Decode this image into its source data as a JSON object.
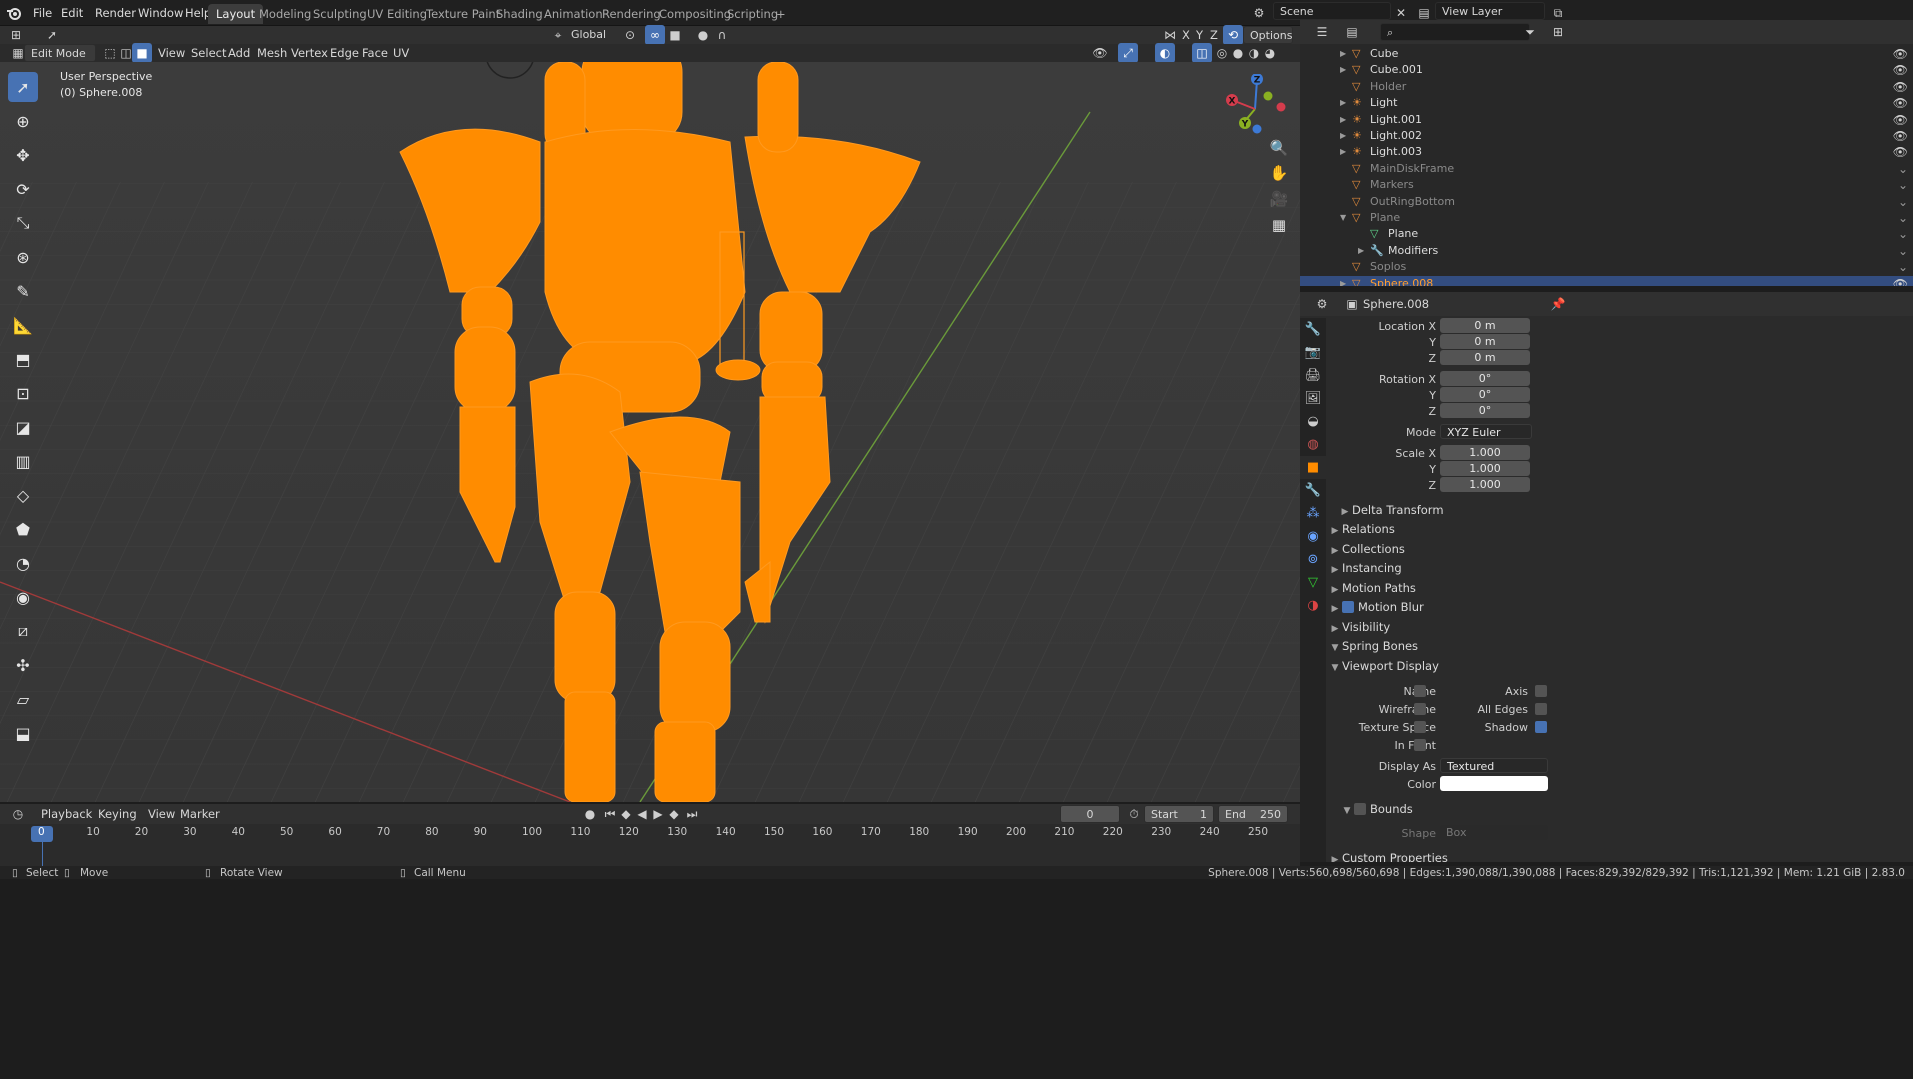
{
  "menu": {
    "items": [
      "File",
      "Edit",
      "Render",
      "Window",
      "Help"
    ]
  },
  "workspaces": {
    "tabs": [
      "Layout",
      "Modeling",
      "Sculpting",
      "UV Editing",
      "Texture Paint",
      "Shading",
      "Animation",
      "Rendering",
      "Compositing",
      "Scripting"
    ],
    "active": "Layout",
    "add": "+"
  },
  "scene": {
    "name": "Scene",
    "view_layer": "View Layer"
  },
  "viewport_header": {
    "mode": "Edit Mode",
    "menus": [
      "View",
      "Select",
      "Add",
      "Mesh",
      "Vertex",
      "Edge",
      "Face",
      "UV"
    ],
    "orientation": "Global",
    "options": "Options",
    "axes": [
      "X",
      "Y",
      "Z"
    ]
  },
  "viewport": {
    "perspective": "User Perspective",
    "object_info": "(0) Sphere.008"
  },
  "gizmo": {
    "x": "X",
    "y": "Y",
    "z": "Z"
  },
  "outliner": {
    "items": [
      {
        "name": "Cube",
        "dim": false,
        "eye": true
      },
      {
        "name": "Cube.001",
        "dim": false,
        "eye": true
      },
      {
        "name": "Holder",
        "dim": true,
        "eye": true
      },
      {
        "name": "Light",
        "dim": false,
        "eye": true
      },
      {
        "name": "Light.001",
        "dim": false,
        "eye": true
      },
      {
        "name": "Light.002",
        "dim": false,
        "eye": true
      },
      {
        "name": "Light.003",
        "dim": false,
        "eye": true
      },
      {
        "name": "MainDiskFrame",
        "dim": true,
        "eye": false
      },
      {
        "name": "Markers",
        "dim": true,
        "eye": false
      },
      {
        "name": "OutRingBottom",
        "dim": true,
        "eye": false
      },
      {
        "name": "Plane",
        "dim": true,
        "eye": false
      },
      {
        "name": "Plane",
        "dim": false,
        "eye": false
      },
      {
        "name": "Modifiers",
        "dim": false,
        "eye": false
      },
      {
        "name": "Soplos",
        "dim": true,
        "eye": false
      },
      {
        "name": "Sphere.008",
        "dim": false,
        "eye": true,
        "selected": true
      }
    ]
  },
  "properties": {
    "object_name": "Sphere.008",
    "location": {
      "label": "Location X",
      "y": "Y",
      "z": "Z",
      "values": [
        "0 m",
        "0 m",
        "0 m"
      ]
    },
    "rotation": {
      "label": "Rotation X",
      "y": "Y",
      "z": "Z",
      "values": [
        "0°",
        "0°",
        "0°"
      ]
    },
    "mode": {
      "label": "Mode",
      "value": "XYZ Euler"
    },
    "scale": {
      "label": "Scale X",
      "y": "Y",
      "z": "Z",
      "values": [
        "1.000",
        "1.000",
        "1.000"
      ]
    },
    "delta_transform": "Delta Transform",
    "panels": [
      "Relations",
      "Collections",
      "Instancing",
      "Motion Paths",
      "Motion Blur",
      "Visibility",
      "Spring Bones",
      "Viewport Display"
    ],
    "viewport_display": {
      "name": "Name",
      "axis": "Axis",
      "wireframe": "Wireframe",
      "all_edges": "All Edges",
      "texture_space": "Texture Space",
      "shadow": "Shadow",
      "in_front": "In Front",
      "display_as_label": "Display As",
      "display_as": "Textured",
      "color": "Color",
      "bounds": "Bounds",
      "shape_label": "Shape",
      "shape": "Box"
    },
    "custom_properties": "Custom Properties"
  },
  "timeline": {
    "menus": [
      "Playback",
      "Keying",
      "View",
      "Marker"
    ],
    "current_frame": "0",
    "start_label": "Start",
    "start": "1",
    "end_label": "End",
    "end": "250",
    "ticks": [
      "0",
      "10",
      "20",
      "30",
      "40",
      "50",
      "60",
      "70",
      "80",
      "90",
      "100",
      "110",
      "120",
      "130",
      "140",
      "150",
      "160",
      "170",
      "180",
      "190",
      "200",
      "210",
      "220",
      "230",
      "240",
      "250"
    ]
  },
  "statusbar": {
    "select": "Select",
    "move": "Move",
    "rotate": "Rotate View",
    "call_menu": "Call Menu",
    "stats": "Sphere.008 | Verts:560,698/560,698 | Edges:1,390,088/1,390,088 | Faces:829,392/829,392 | Tris:1,121,392 | Mem: 1.21 GiB | 2.83.0"
  },
  "colors": {
    "accent": "#4772b3",
    "selection": "#ff8c00",
    "grid": "#454545"
  }
}
